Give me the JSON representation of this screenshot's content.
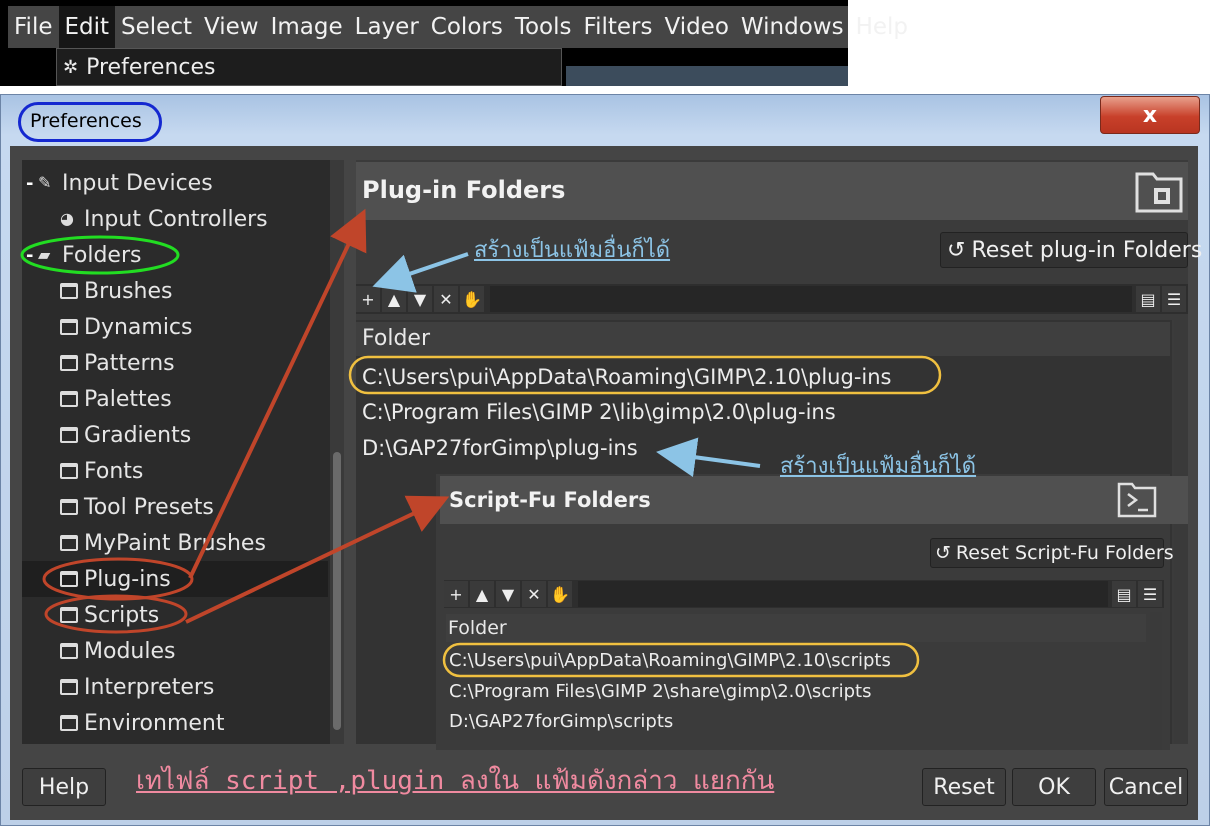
{
  "menubar": {
    "items": [
      "File",
      "Edit",
      "Select",
      "View",
      "Image",
      "Layer",
      "Colors",
      "Tools",
      "Filters",
      "Video",
      "Windows",
      "Help"
    ],
    "open_menu_item": "Preferences"
  },
  "window": {
    "title": "Preferences",
    "close_glyph": "x"
  },
  "tree": {
    "items": [
      {
        "label": "Input Devices",
        "expander": "-",
        "icon": "input-devices-icon"
      },
      {
        "label": "Input Controllers",
        "icon": "input-controllers-icon"
      },
      {
        "label": "Folders",
        "expander": "-",
        "icon": "folders-icon"
      },
      {
        "label": "Brushes",
        "icon": "folder-icon"
      },
      {
        "label": "Dynamics",
        "icon": "folder-icon"
      },
      {
        "label": "Patterns",
        "icon": "folder-icon"
      },
      {
        "label": "Palettes",
        "icon": "folder-icon"
      },
      {
        "label": "Gradients",
        "icon": "folder-icon"
      },
      {
        "label": "Fonts",
        "icon": "folder-icon"
      },
      {
        "label": "Tool Presets",
        "icon": "folder-icon"
      },
      {
        "label": "MyPaint Brushes",
        "icon": "folder-icon"
      },
      {
        "label": "Plug-ins",
        "icon": "folder-icon",
        "selected": true
      },
      {
        "label": "Scripts",
        "icon": "folder-icon"
      },
      {
        "label": "Modules",
        "icon": "folder-icon"
      },
      {
        "label": "Interpreters",
        "icon": "folder-icon"
      },
      {
        "label": "Environment",
        "icon": "folder-icon"
      }
    ]
  },
  "plugin_folders": {
    "title": "Plug-in Folders",
    "reset_label": "Reset plug-in Folders",
    "column_header": "Folder",
    "rows": [
      "C:\\Users\\pui\\AppData\\Roaming\\GIMP\\2.10\\plug-ins",
      "C:\\Program Files\\GIMP 2\\lib\\gimp\\2.0\\plug-ins",
      "D:\\GAP27forGimp\\plug-ins"
    ]
  },
  "script_fu_folders": {
    "title": "Script-Fu Folders",
    "reset_label": "Reset Script-Fu Folders",
    "column_header": "Folder",
    "rows": [
      "C:\\Users\\pui\\AppData\\Roaming\\GIMP\\2.10\\scripts",
      "C:\\Program Files\\GIMP 2\\share\\gimp\\2.0\\scripts",
      "D:\\GAP27forGimp\\scripts"
    ]
  },
  "buttons": {
    "help": "Help",
    "reset": "Reset",
    "ok": "OK",
    "cancel": "Cancel"
  },
  "annotations": {
    "note_top": "สร้างเป็นแฟ้มอื่นก็ได้",
    "note_middle": "สร้างเป็นแฟ้มอื่นก็ได้",
    "note_bottom": "เทไฟล์ script ,plugin  ลงใน แฟ้มดังกล่าว แยกกัน"
  },
  "colors": {
    "annotation_blue_oval": "#1428d0",
    "annotation_green_oval": "#22dd22",
    "annotation_red": "#c0452a",
    "annotation_yellow_oval": "#f0c040",
    "annotation_light_blue": "#8cc4e6",
    "annotation_pink": "#f08aa0"
  }
}
